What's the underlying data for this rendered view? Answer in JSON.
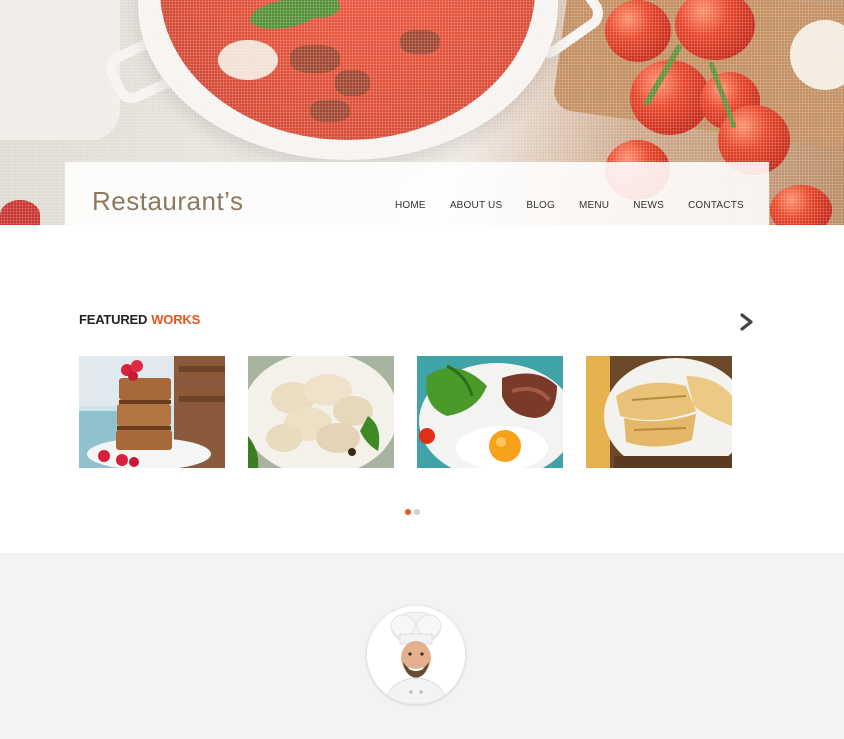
{
  "site": {
    "logo": "Restaurant’s"
  },
  "nav": {
    "items": [
      {
        "label": "HOME"
      },
      {
        "label": "ABOUT US"
      },
      {
        "label": "BLOG"
      },
      {
        "label": "MENU"
      },
      {
        "label": "NEWS"
      },
      {
        "label": "CONTACTS"
      }
    ]
  },
  "featured": {
    "title_part1": "FEATURED",
    "title_part2": "WORKS",
    "accent_color": "#e9561a",
    "next_icon": "chevron-right-icon",
    "items": [
      {
        "image": "layered-pastry-cake-with-raspberries"
      },
      {
        "image": "dumplings-with-parsley"
      },
      {
        "image": "fried-egg-with-beef-and-salad"
      },
      {
        "image": "stuffed-crepes-on-plate"
      }
    ],
    "pagination": {
      "pages": 2,
      "active": 1
    }
  },
  "chef": {
    "image": "chef-portrait-avatar"
  },
  "colors": {
    "logo": "#8c7a5e",
    "accent": "#e9561a",
    "section_bg": "#f3f3f3"
  }
}
